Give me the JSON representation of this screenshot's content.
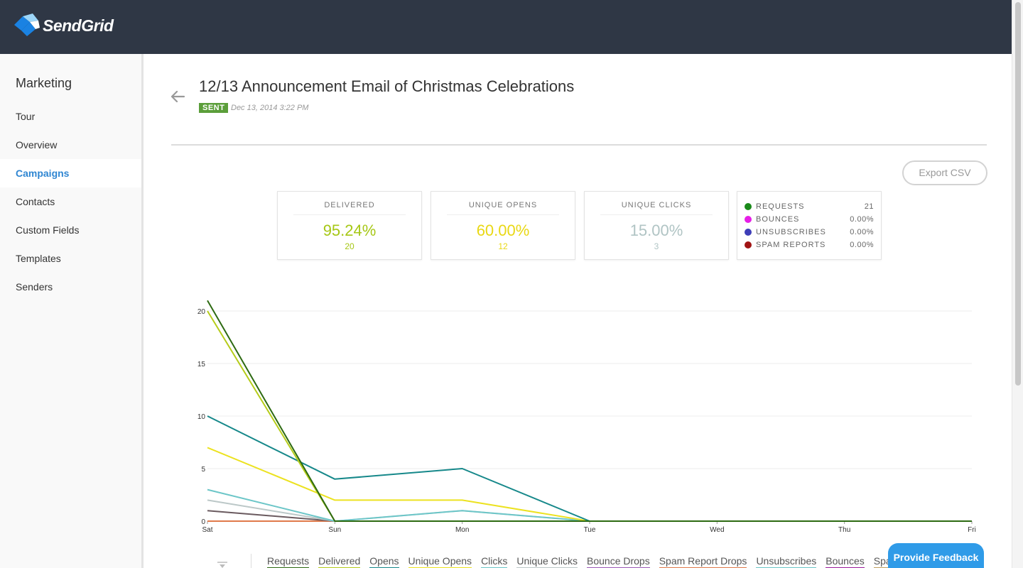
{
  "brand": {
    "name": "SendGrid"
  },
  "sidebar": {
    "title": "Marketing",
    "items": [
      {
        "label": "Tour",
        "active": false
      },
      {
        "label": "Overview",
        "active": false
      },
      {
        "label": "Campaigns",
        "active": true
      },
      {
        "label": "Contacts",
        "active": false
      },
      {
        "label": "Custom Fields",
        "active": false
      },
      {
        "label": "Templates",
        "active": false
      },
      {
        "label": "Senders",
        "active": false
      }
    ]
  },
  "campaign": {
    "title": "12/13 Announcement Email of Christmas Celebrations",
    "status": "SENT",
    "date": "Dec 13, 2014 3:22 PM"
  },
  "toolbar": {
    "export_label": "Export CSV"
  },
  "stats": {
    "delivered": {
      "label": "DELIVERED",
      "value": "95.24%",
      "count": "20",
      "color": "#a6c715"
    },
    "unique_opens": {
      "label": "UNIQUE OPENS",
      "value": "60.00%",
      "count": "12",
      "color": "#e9d814"
    },
    "unique_clicks": {
      "label": "UNIQUE CLICKS",
      "value": "15.00%",
      "count": "3",
      "color": "#b0c4c4"
    }
  },
  "legend": [
    {
      "label": "REQUESTS",
      "value": "21",
      "color": "#1a8a1a"
    },
    {
      "label": "BOUNCES",
      "value": "0.00%",
      "color": "#e61ee6"
    },
    {
      "label": "UNSUBSCRIBES",
      "value": "0.00%",
      "color": "#3e3eb8"
    },
    {
      "label": "SPAM REPORTS",
      "value": "0.00%",
      "color": "#a01414"
    }
  ],
  "chart_data": {
    "type": "line",
    "x": [
      "Sat",
      "Sun",
      "Mon",
      "Tue",
      "Wed",
      "Thu",
      "Fri"
    ],
    "ylim": [
      0,
      20
    ],
    "yticks": [
      0,
      5,
      10,
      15,
      20
    ],
    "grid": true,
    "series": [
      {
        "name": "Requests",
        "color": "#2d6a12",
        "values": [
          21,
          0,
          0,
          0,
          0,
          0,
          0
        ]
      },
      {
        "name": "Delivered",
        "color": "#b5cc1a",
        "values": [
          20,
          0,
          0,
          0,
          0,
          0,
          0
        ]
      },
      {
        "name": "Opens",
        "color": "#16888a",
        "values": [
          10,
          4,
          5,
          0,
          0,
          0,
          0
        ]
      },
      {
        "name": "Unique Opens",
        "color": "#ece220",
        "values": [
          7,
          2,
          2,
          0,
          0,
          0,
          0
        ]
      },
      {
        "name": "Clicks",
        "color": "#6cc6c8",
        "values": [
          3,
          0,
          1,
          0,
          0,
          0,
          0
        ]
      },
      {
        "name": "Unique Clicks",
        "color": "#bcc8c8",
        "values": [
          2,
          0,
          1,
          0,
          0,
          0,
          0
        ]
      },
      {
        "name": "Bounce Drops",
        "color": "#6a5a5f",
        "values": [
          1,
          0,
          0,
          0,
          0,
          0,
          0
        ]
      },
      {
        "name": "Spam Report Drops",
        "color": "#e07a4a",
        "values": [
          0,
          0,
          0,
          0,
          0,
          0,
          0
        ]
      }
    ]
  },
  "series_links": [
    {
      "label": "Requests",
      "color": "#2d6a12"
    },
    {
      "label": "Delivered",
      "color": "#b5cc1a"
    },
    {
      "label": "Opens",
      "color": "#16888a"
    },
    {
      "label": "Unique Opens",
      "color": "#ece220"
    },
    {
      "label": "Clicks",
      "color": "#6cc6c8"
    },
    {
      "label": "Unique Clicks",
      "color": "#bcc8c8"
    },
    {
      "label": "Bounce Drops",
      "color": "#9b59b6"
    },
    {
      "label": "Spam Report Drops",
      "color": "#e07a4a"
    },
    {
      "label": "Unsubscribes",
      "color": "#6cc6c8"
    },
    {
      "label": "Bounces",
      "color": "#9b1b9b"
    },
    {
      "label": "Spam Reports",
      "color": "#c0a060"
    }
  ],
  "feedback": {
    "label": "Provide Feedback"
  }
}
